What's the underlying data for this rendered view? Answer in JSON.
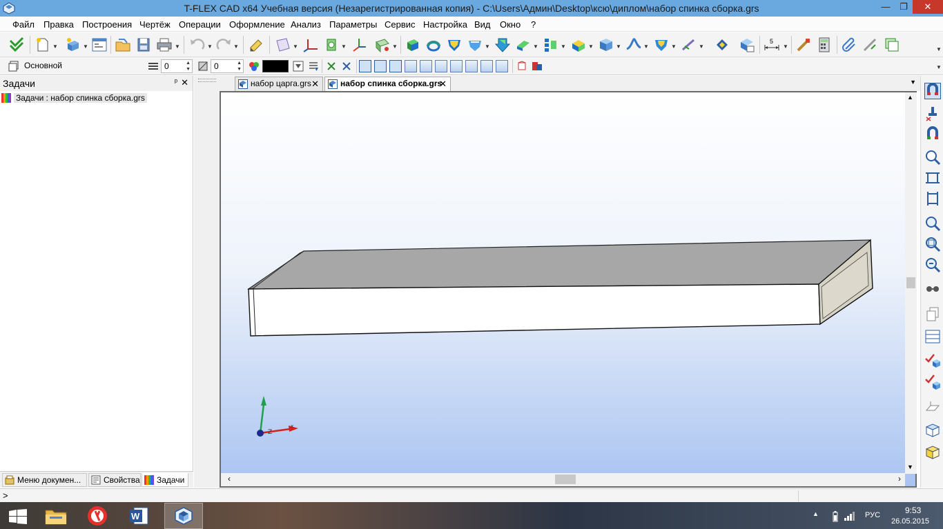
{
  "window": {
    "title": "T-FLEX CAD x64 Учебная версия (Незарегистрированная копия) - C:\\Users\\Админ\\Desktop\\ксю\\диплом\\набор спинка сборка.grs",
    "minimize": "—",
    "maximize": "❐",
    "close": "✕"
  },
  "menu": [
    "Файл",
    "Правка",
    "Построения",
    "Чертёж",
    "Операции",
    "Оформление",
    "Анализ",
    "Параметры",
    "Сервис",
    "Настройка",
    "Вид",
    "Окно",
    "?"
  ],
  "toolbar2": {
    "view_label": "Основной",
    "layer_value": "0",
    "level_value": "0",
    "color_value": "#000000"
  },
  "left_panel": {
    "title": "Задачи",
    "pin": "ᵖ",
    "close": "✕",
    "task_item": "Задачи : набор спинка сборка.grs",
    "tabs": [
      "Меню докумен...",
      "Свойства",
      "Задачи"
    ]
  },
  "document_tabs": [
    {
      "label": "набор царга.grs",
      "active": false
    },
    {
      "label": "набор спинка сборка.grs",
      "active": true
    }
  ],
  "viewport": {
    "axis_z_label": "Z",
    "axis_x_label": "x"
  },
  "command_line": {
    "prompt": ">"
  },
  "taskbar": {
    "apps": [
      "start-button",
      "file-explorer",
      "yandex-browser",
      "microsoft-word",
      "t-flex-cad"
    ],
    "active_app": "t-flex-cad",
    "language": "РУС",
    "time": "9:53",
    "date": "26.05.2015"
  },
  "colors": {
    "titlebar": "#6aa9df",
    "close_button": "#c7372a",
    "viewport_top": "#ffffff",
    "viewport_bottom": "#a9c3f1",
    "box_front": "#ffffff",
    "box_top": "#a7a7a7",
    "box_side": "#d6d3c4"
  }
}
